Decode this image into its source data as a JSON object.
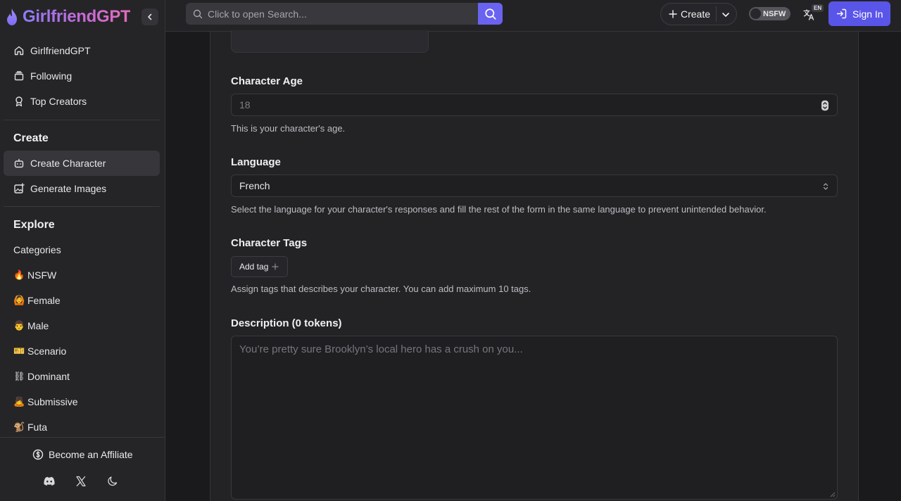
{
  "brand": {
    "name": "GirlfriendGPT"
  },
  "sidebar": {
    "top_items": [
      {
        "label": "GirlfriendGPT",
        "icon": "home-icon"
      },
      {
        "label": "Following",
        "icon": "stack-icon"
      },
      {
        "label": "Top Creators",
        "icon": "award-icon"
      }
    ],
    "create_title": "Create",
    "create_items": [
      {
        "label": "Create Character",
        "icon": "robot-icon",
        "active": true
      },
      {
        "label": "Generate Images",
        "icon": "image-plus-icon"
      }
    ],
    "explore_title": "Explore",
    "explore_items": [
      {
        "label": "Categories",
        "emoji": ""
      },
      {
        "label": "NSFW",
        "emoji": "🔥"
      },
      {
        "label": "Female",
        "emoji": "🙆"
      },
      {
        "label": "Male",
        "emoji": "👨"
      },
      {
        "label": "Scenario",
        "emoji": "🎫"
      },
      {
        "label": "Dominant",
        "emoji": "⛓"
      },
      {
        "label": "Submissive",
        "emoji": "🙇"
      },
      {
        "label": "Futa",
        "emoji": "🐒"
      }
    ],
    "affiliate_label": "Become an Affiliate"
  },
  "topbar": {
    "search_placeholder": "Click to open Search...",
    "create_label": "Create",
    "nsfw_label": "NSFW",
    "lang_badge": "EN",
    "signin_label": "Sign In"
  },
  "form": {
    "age": {
      "label": "Character Age",
      "value": "18",
      "helper": "This is your character's age."
    },
    "language": {
      "label": "Language",
      "value": "French",
      "helper": "Select the language for your character's responses and fill the rest of the form in the same language to prevent unintended behavior."
    },
    "tags": {
      "label": "Character Tags",
      "button": "Add tag",
      "helper": "Assign tags that describes your character. You can add maximum 10 tags."
    },
    "description": {
      "label": "Description (0 tokens)",
      "placeholder": "You’re pretty sure Brooklyn’s local hero has a crush on you..."
    }
  },
  "colors": {
    "accent": "#5a55e9",
    "search_button": "#6a63f0",
    "background": "#1a1a1d",
    "sidebar": "#252528"
  }
}
